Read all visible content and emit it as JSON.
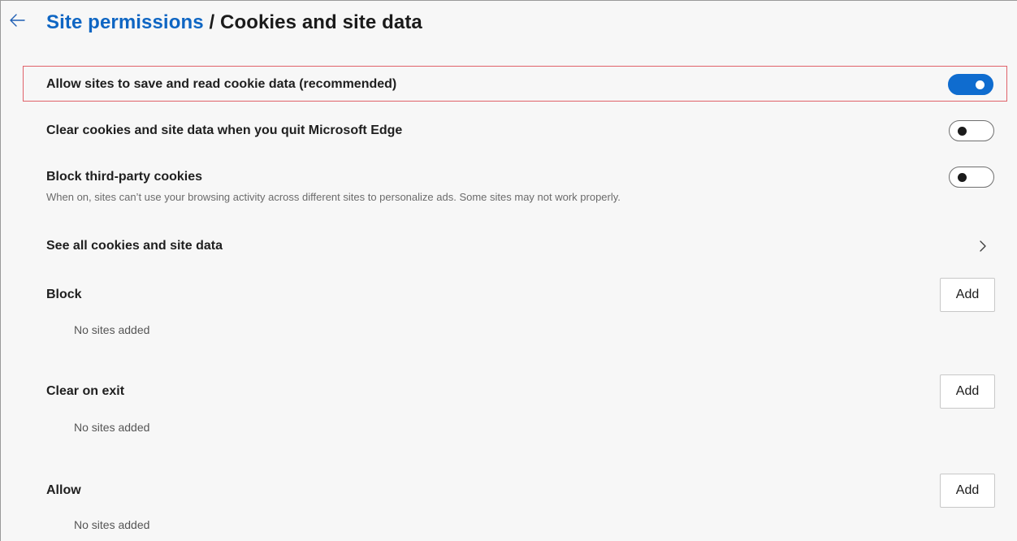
{
  "header": {
    "breadcrumb_parent": "Site permissions",
    "separator": "/",
    "current": "Cookies and site data"
  },
  "settings": {
    "allow_cookies": {
      "label": "Allow sites to save and read cookie data (recommended)",
      "state": "on"
    },
    "clear_on_quit": {
      "label": "Clear cookies and site data when you quit Microsoft Edge",
      "state": "off"
    },
    "block_third_party": {
      "label": "Block third-party cookies",
      "description": "When on, sites can’t use your browsing activity across different sites to personalize ads. Some sites may not work properly.",
      "state": "off"
    },
    "see_all": {
      "label": "See all cookies and site data"
    }
  },
  "lists": {
    "block": {
      "title": "Block",
      "add_label": "Add",
      "empty_text": "No sites added"
    },
    "clear_on_exit": {
      "title": "Clear on exit",
      "add_label": "Add",
      "empty_text": "No sites added"
    },
    "allow": {
      "title": "Allow",
      "add_label": "Add",
      "empty_text": "No sites added"
    }
  },
  "colors": {
    "accent": "#0f6ccf",
    "link": "#0f66c3",
    "highlight_border": "#e0626a",
    "background": "#f7f7f7"
  },
  "icons": {
    "back": "arrow-left-icon",
    "see_all": "chevron-right-icon"
  }
}
